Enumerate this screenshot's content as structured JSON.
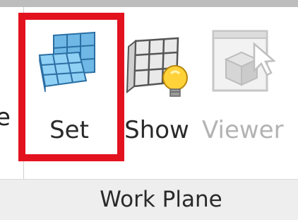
{
  "ribbon": {
    "prev_group_partial_label": "e",
    "group_title": "Work Plane",
    "buttons": [
      {
        "label": "Set",
        "icon": "workplane-set-icon",
        "state": "highlighted"
      },
      {
        "label": "Show",
        "icon": "workplane-show-icon",
        "state": "enabled"
      },
      {
        "label": "Viewer",
        "icon": "workplane-viewer-icon",
        "state": "disabled"
      }
    ]
  },
  "colors": {
    "highlight_border": "#e3121f",
    "disabled_text": "#b3b3b3",
    "panel_band": "#eeeeee"
  }
}
